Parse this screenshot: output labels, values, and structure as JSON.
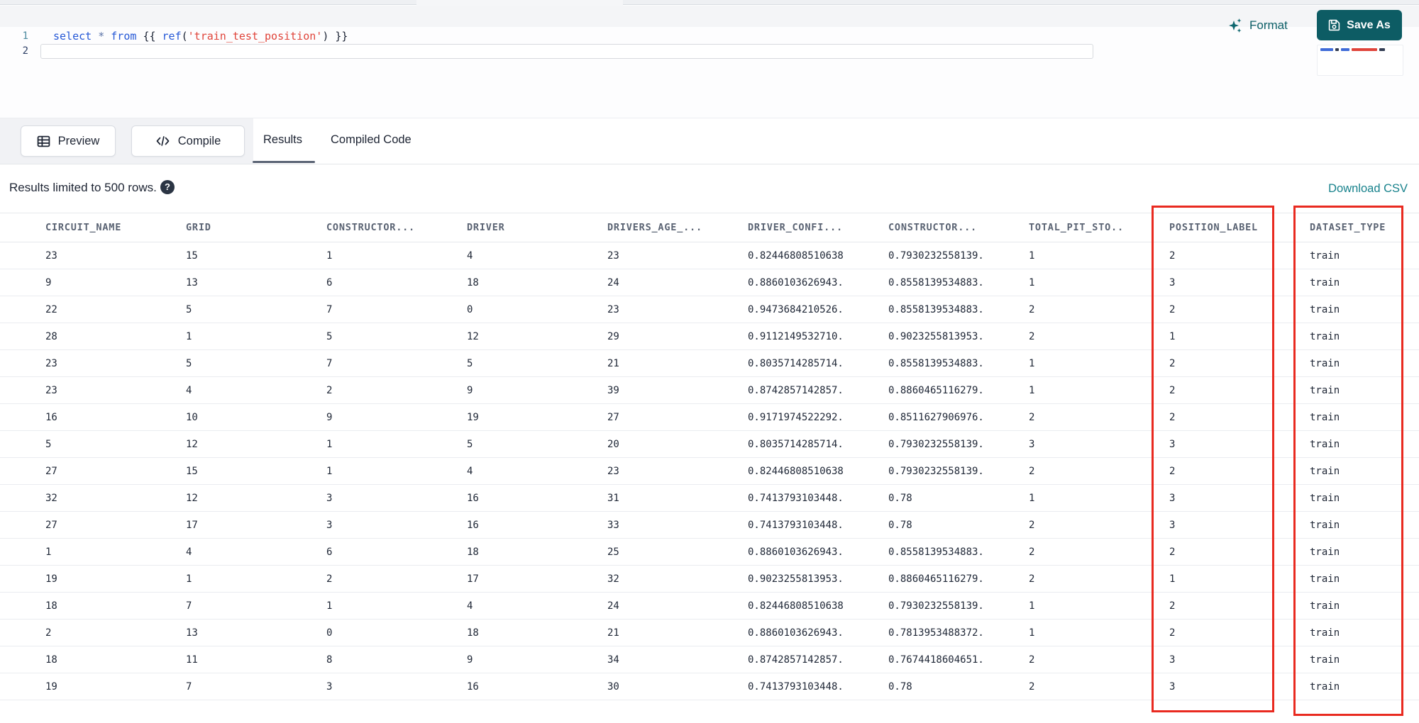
{
  "editor": {
    "line_numbers": [
      "1",
      "2"
    ],
    "tokens": [
      {
        "t": "select "
      },
      {
        "t": "* "
      },
      {
        "t": "from "
      },
      {
        "t": "{{ "
      },
      {
        "t": "ref"
      },
      {
        "t": "("
      },
      {
        "t": "'train_test_position'"
      },
      {
        "t": ") "
      },
      {
        "t": "}}"
      }
    ],
    "format_label": "Format",
    "save_as_label": "Save As"
  },
  "toolbar": {
    "preview_label": "Preview",
    "compile_label": "Compile",
    "tabs": [
      {
        "label": "Results",
        "active": true
      },
      {
        "label": "Compiled Code",
        "active": false
      }
    ]
  },
  "results": {
    "limit_notice": "Results limited to 500 rows.",
    "download_csv_label": "Download CSV"
  },
  "icons": {
    "help_glyph": "?"
  },
  "table": {
    "columns": [
      "CIRCUIT_NAME",
      "GRID",
      "CONSTRUCTOR...",
      "DRIVER",
      "DRIVERS_AGE_...",
      "DRIVER_CONFI...",
      "CONSTRUCTOR...",
      "TOTAL_PIT_STO...",
      "POSITION_LABEL",
      "DATASET_TYPE"
    ],
    "highlighted_columns": [
      "POSITION_LABEL",
      "DATASET_TYPE"
    ],
    "rows": [
      [
        "23",
        "15",
        "1",
        "4",
        "23",
        "0.824468085106383",
        "0.7930232558139...",
        "1",
        "2",
        "train"
      ],
      [
        "9",
        "13",
        "6",
        "18",
        "24",
        "0.8860103626943...",
        "0.8558139534883...",
        "1",
        "3",
        "train"
      ],
      [
        "22",
        "5",
        "7",
        "0",
        "23",
        "0.9473684210526...",
        "0.8558139534883...",
        "2",
        "2",
        "train"
      ],
      [
        "28",
        "1",
        "5",
        "12",
        "29",
        "0.9112149532710...",
        "0.9023255813953...",
        "2",
        "1",
        "train"
      ],
      [
        "23",
        "5",
        "7",
        "5",
        "21",
        "0.8035714285714...",
        "0.8558139534883...",
        "1",
        "2",
        "train"
      ],
      [
        "23",
        "4",
        "2",
        "9",
        "39",
        "0.8742857142857...",
        "0.8860465116279...",
        "1",
        "2",
        "train"
      ],
      [
        "16",
        "10",
        "9",
        "19",
        "27",
        "0.9171974522292...",
        "0.8511627906976...",
        "2",
        "2",
        "train"
      ],
      [
        "5",
        "12",
        "1",
        "5",
        "20",
        "0.8035714285714...",
        "0.7930232558139...",
        "3",
        "3",
        "train"
      ],
      [
        "27",
        "15",
        "1",
        "4",
        "23",
        "0.824468085106383",
        "0.7930232558139...",
        "2",
        "2",
        "train"
      ],
      [
        "32",
        "12",
        "3",
        "16",
        "31",
        "0.7413793103448...",
        "0.78",
        "1",
        "3",
        "train"
      ],
      [
        "27",
        "17",
        "3",
        "16",
        "33",
        "0.7413793103448...",
        "0.78",
        "2",
        "3",
        "train"
      ],
      [
        "1",
        "4",
        "6",
        "18",
        "25",
        "0.8860103626943...",
        "0.8558139534883...",
        "2",
        "2",
        "train"
      ],
      [
        "19",
        "1",
        "2",
        "17",
        "32",
        "0.9023255813953...",
        "0.8860465116279...",
        "2",
        "1",
        "train"
      ],
      [
        "18",
        "7",
        "1",
        "4",
        "24",
        "0.824468085106383",
        "0.7930232558139...",
        "1",
        "2",
        "train"
      ],
      [
        "2",
        "13",
        "0",
        "18",
        "21",
        "0.8860103626943...",
        "0.7813953488372...",
        "1",
        "2",
        "train"
      ],
      [
        "18",
        "11",
        "8",
        "9",
        "34",
        "0.8742857142857...",
        "0.7674418604651...",
        "2",
        "3",
        "train"
      ],
      [
        "19",
        "7",
        "3",
        "16",
        "30",
        "0.7413793103448...",
        "0.78",
        "2",
        "3",
        "train"
      ]
    ]
  },
  "colors": {
    "accent_teal": "#0d5c64",
    "link_teal": "#18828c",
    "highlight_red": "#e92a20",
    "keyword_blue": "#2457d6",
    "string_red": "#e0443a"
  }
}
